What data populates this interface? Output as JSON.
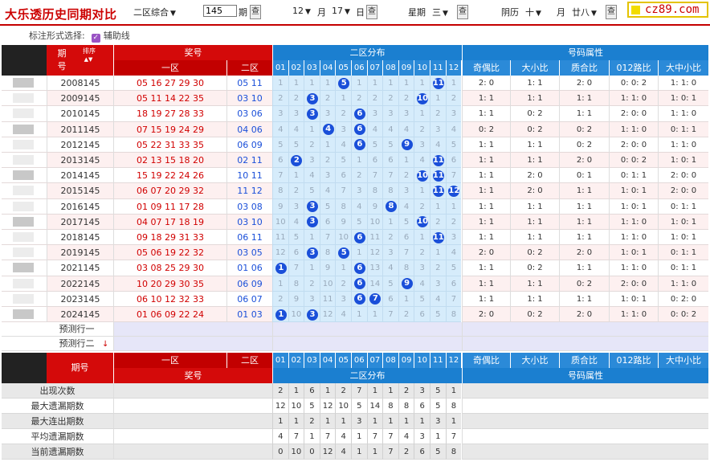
{
  "topbar": {
    "title": "大乐透历史同期对比",
    "mode": "二区综合",
    "issue_value": "145",
    "issue_unit": "期",
    "query": "查",
    "month": "12",
    "month_unit": "月",
    "day": "17",
    "day_unit": "日",
    "week_label": "星期",
    "week": "三",
    "lunar_label": "阴历",
    "lunar_month": "十",
    "lunar_month_unit": "月",
    "lunar_day": "廿八",
    "logo_text": "cz89.com"
  },
  "options": {
    "label": "标注形式选择:",
    "checkbox_label": "辅助线"
  },
  "header": {
    "issue": "期号",
    "sort": "排序",
    "prize": "奖号",
    "zone1": "一区",
    "zone2": "二区",
    "distribution": "二区分布",
    "attributes": "号码属性",
    "attr_cols": [
      "奇偶比",
      "大小比",
      "质合比",
      "012路比",
      "大中小比"
    ]
  },
  "rows": [
    {
      "issue": "2008145",
      "front": "05 16 27 29 30",
      "back": "05 11",
      "dist": [
        "1",
        "1",
        "1",
        "1",
        "5",
        "1",
        "1",
        "1",
        "1",
        "1",
        "11",
        "1"
      ],
      "attrs": [
        "2: 0",
        "1: 1",
        "2: 0",
        "0: 0: 2",
        "1: 1: 0"
      ]
    },
    {
      "issue": "2009145",
      "front": "05 11 14 22 35",
      "back": "03 10",
      "dist": [
        "2",
        "2",
        "3",
        "2",
        "1",
        "2",
        "2",
        "2",
        "2",
        "10",
        "1",
        "2"
      ],
      "attrs": [
        "1: 1",
        "1: 1",
        "1: 1",
        "1: 1: 0",
        "1: 0: 1"
      ]
    },
    {
      "issue": "2010145",
      "front": "18 19 27 28 33",
      "back": "03 06",
      "dist": [
        "3",
        "3",
        "3",
        "3",
        "2",
        "6",
        "3",
        "3",
        "3",
        "1",
        "2",
        "3"
      ],
      "attrs": [
        "1: 1",
        "0: 2",
        "1: 1",
        "2: 0: 0",
        "1: 1: 0"
      ]
    },
    {
      "issue": "2011145",
      "front": "07 15 19 24 29",
      "back": "04 06",
      "dist": [
        "4",
        "4",
        "1",
        "4",
        "3",
        "6",
        "4",
        "4",
        "4",
        "2",
        "3",
        "4"
      ],
      "attrs": [
        "0: 2",
        "0: 2",
        "0: 2",
        "1: 1: 0",
        "0: 1: 1"
      ]
    },
    {
      "issue": "2012145",
      "front": "05 22 31 33 35",
      "back": "06 09",
      "dist": [
        "5",
        "5",
        "2",
        "1",
        "4",
        "6",
        "5",
        "5",
        "9",
        "3",
        "4",
        "5"
      ],
      "attrs": [
        "1: 1",
        "1: 1",
        "0: 2",
        "2: 0: 0",
        "1: 1: 0"
      ]
    },
    {
      "issue": "2013145",
      "front": "02 13 15 18 20",
      "back": "02 11",
      "dist": [
        "6",
        "2",
        "3",
        "2",
        "5",
        "1",
        "6",
        "6",
        "1",
        "4",
        "11",
        "6"
      ],
      "attrs": [
        "1: 1",
        "1: 1",
        "2: 0",
        "0: 0: 2",
        "1: 0: 1"
      ]
    },
    {
      "issue": "2014145",
      "front": "15 19 22 24 26",
      "back": "10 11",
      "dist": [
        "7",
        "1",
        "4",
        "3",
        "6",
        "2",
        "7",
        "7",
        "2",
        "10",
        "11",
        "7"
      ],
      "attrs": [
        "1: 1",
        "2: 0",
        "0: 1",
        "0: 1: 1",
        "2: 0: 0"
      ]
    },
    {
      "issue": "2015145",
      "front": "06 07 20 29 32",
      "back": "11 12",
      "dist": [
        "8",
        "2",
        "5",
        "4",
        "7",
        "3",
        "8",
        "8",
        "3",
        "1",
        "11",
        "12"
      ],
      "attrs": [
        "1: 1",
        "2: 0",
        "1: 1",
        "1: 0: 1",
        "2: 0: 0"
      ]
    },
    {
      "issue": "2016145",
      "front": "01 09 11 17 28",
      "back": "03 08",
      "dist": [
        "9",
        "3",
        "3",
        "5",
        "8",
        "4",
        "9",
        "8",
        "4",
        "2",
        "1",
        "1"
      ],
      "attrs": [
        "1: 1",
        "1: 1",
        "1: 1",
        "1: 0: 1",
        "0: 1: 1"
      ]
    },
    {
      "issue": "2017145",
      "front": "04 07 17 18 19",
      "back": "03 10",
      "dist": [
        "10",
        "4",
        "3",
        "6",
        "9",
        "5",
        "10",
        "1",
        "5",
        "10",
        "2",
        "2"
      ],
      "attrs": [
        "1: 1",
        "1: 1",
        "1: 1",
        "1: 1: 0",
        "1: 0: 1"
      ]
    },
    {
      "issue": "2018145",
      "front": "09 18 29 31 33",
      "back": "06 11",
      "dist": [
        "11",
        "5",
        "1",
        "7",
        "10",
        "6",
        "11",
        "2",
        "6",
        "1",
        "11",
        "3"
      ],
      "attrs": [
        "1: 1",
        "1: 1",
        "1: 1",
        "1: 1: 0",
        "1: 0: 1"
      ]
    },
    {
      "issue": "2019145",
      "front": "05 06 19 22 32",
      "back": "03 05",
      "dist": [
        "12",
        "6",
        "3",
        "8",
        "5",
        "1",
        "12",
        "3",
        "7",
        "2",
        "1",
        "4"
      ],
      "attrs": [
        "2: 0",
        "0: 2",
        "2: 0",
        "1: 0: 1",
        "0: 1: 1"
      ]
    },
    {
      "issue": "2021145",
      "front": "03 08 25 29 30",
      "back": "01 06",
      "dist": [
        "1",
        "7",
        "1",
        "9",
        "1",
        "6",
        "13",
        "4",
        "8",
        "3",
        "2",
        "5"
      ],
      "attrs": [
        "1: 1",
        "0: 2",
        "1: 1",
        "1: 1: 0",
        "0: 1: 1"
      ]
    },
    {
      "issue": "2022145",
      "front": "10 20 29 30 35",
      "back": "06 09",
      "dist": [
        "1",
        "8",
        "2",
        "10",
        "2",
        "6",
        "14",
        "5",
        "9",
        "4",
        "3",
        "6"
      ],
      "attrs": [
        "1: 1",
        "1: 1",
        "0: 2",
        "2: 0: 0",
        "1: 1: 0"
      ]
    },
    {
      "issue": "2023145",
      "front": "06 10 12 32 33",
      "back": "06 07",
      "dist": [
        "2",
        "9",
        "3",
        "11",
        "3",
        "6",
        "7",
        "6",
        "1",
        "5",
        "4",
        "7"
      ],
      "attrs": [
        "1: 1",
        "1: 1",
        "1: 1",
        "1: 0: 1",
        "0: 2: 0"
      ]
    },
    {
      "issue": "2024145",
      "front": "01 06 09 22 24",
      "back": "01 03",
      "dist": [
        "1",
        "10",
        "3",
        "12",
        "4",
        "1",
        "1",
        "7",
        "2",
        "6",
        "5",
        "8"
      ],
      "attrs": [
        "2: 0",
        "0: 2",
        "2: 0",
        "1: 1: 0",
        "0: 0: 2"
      ]
    }
  ],
  "hits": [
    [
      5,
      11
    ],
    [
      3,
      10
    ],
    [
      3,
      6
    ],
    [
      4,
      6
    ],
    [
      6,
      9
    ],
    [
      2,
      11
    ],
    [
      10,
      11
    ],
    [
      11,
      12
    ],
    [
      3,
      8
    ],
    [
      3,
      10
    ],
    [
      6,
      11
    ],
    [
      3,
      5
    ],
    [
      1,
      6
    ],
    [
      6,
      9
    ],
    [
      6,
      7
    ],
    [
      1,
      3
    ]
  ],
  "predict": [
    "预测行一",
    "预测行二"
  ],
  "zone2_numbers": [
    "01",
    "02",
    "03",
    "04",
    "05",
    "06",
    "07",
    "08",
    "09",
    "10",
    "11",
    "12"
  ],
  "stats": [
    {
      "label": "出现次数",
      "values": [
        "2",
        "1",
        "6",
        "1",
        "2",
        "7",
        "1",
        "1",
        "2",
        "3",
        "5",
        "1"
      ]
    },
    {
      "label": "最大遗漏期数",
      "values": [
        "12",
        "10",
        "5",
        "12",
        "10",
        "5",
        "14",
        "8",
        "8",
        "6",
        "5",
        "8"
      ]
    },
    {
      "label": "最大连出期数",
      "values": [
        "1",
        "1",
        "2",
        "1",
        "1",
        "3",
        "1",
        "1",
        "1",
        "1",
        "3",
        "1"
      ]
    },
    {
      "label": "平均遗漏期数",
      "values": [
        "4",
        "7",
        "1",
        "7",
        "4",
        "1",
        "7",
        "7",
        "4",
        "3",
        "1",
        "7"
      ]
    },
    {
      "label": "当前遗漏期数",
      "values": [
        "0",
        "10",
        "0",
        "12",
        "4",
        "1",
        "1",
        "7",
        "2",
        "6",
        "5",
        "8"
      ]
    }
  ],
  "colors": {
    "red": "#d40a0a",
    "blue": "#1b7fd0",
    "ball": "#1a4fd9",
    "pink": "#fce8e8",
    "lightblue": "#d6ecfb"
  }
}
